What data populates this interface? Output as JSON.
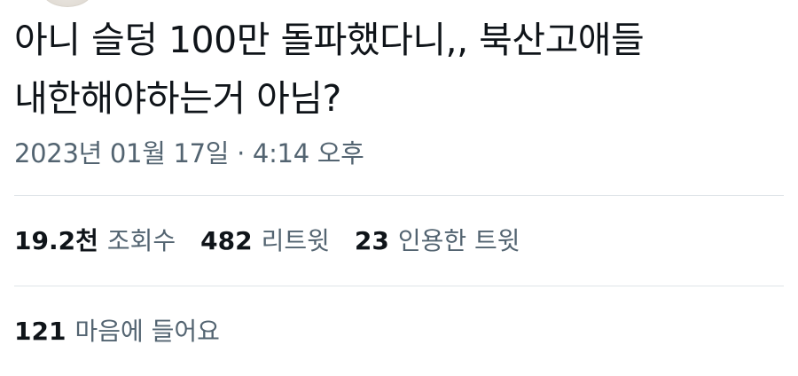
{
  "tweet": {
    "text": "아니 슬덩 100만 돌파했다니,, 북산고애들\n내한해야하는거 아님?",
    "timestamp": "2023년 01월 17일 · 4:14 오후"
  },
  "stats": {
    "views": {
      "count": "19.2천",
      "label": "조회수"
    },
    "retweets": {
      "count": "482",
      "label": "리트윗"
    },
    "quotes": {
      "count": "23",
      "label": "인용한 트윗"
    },
    "likes": {
      "count": "121",
      "label": "마음에 들어요"
    }
  }
}
